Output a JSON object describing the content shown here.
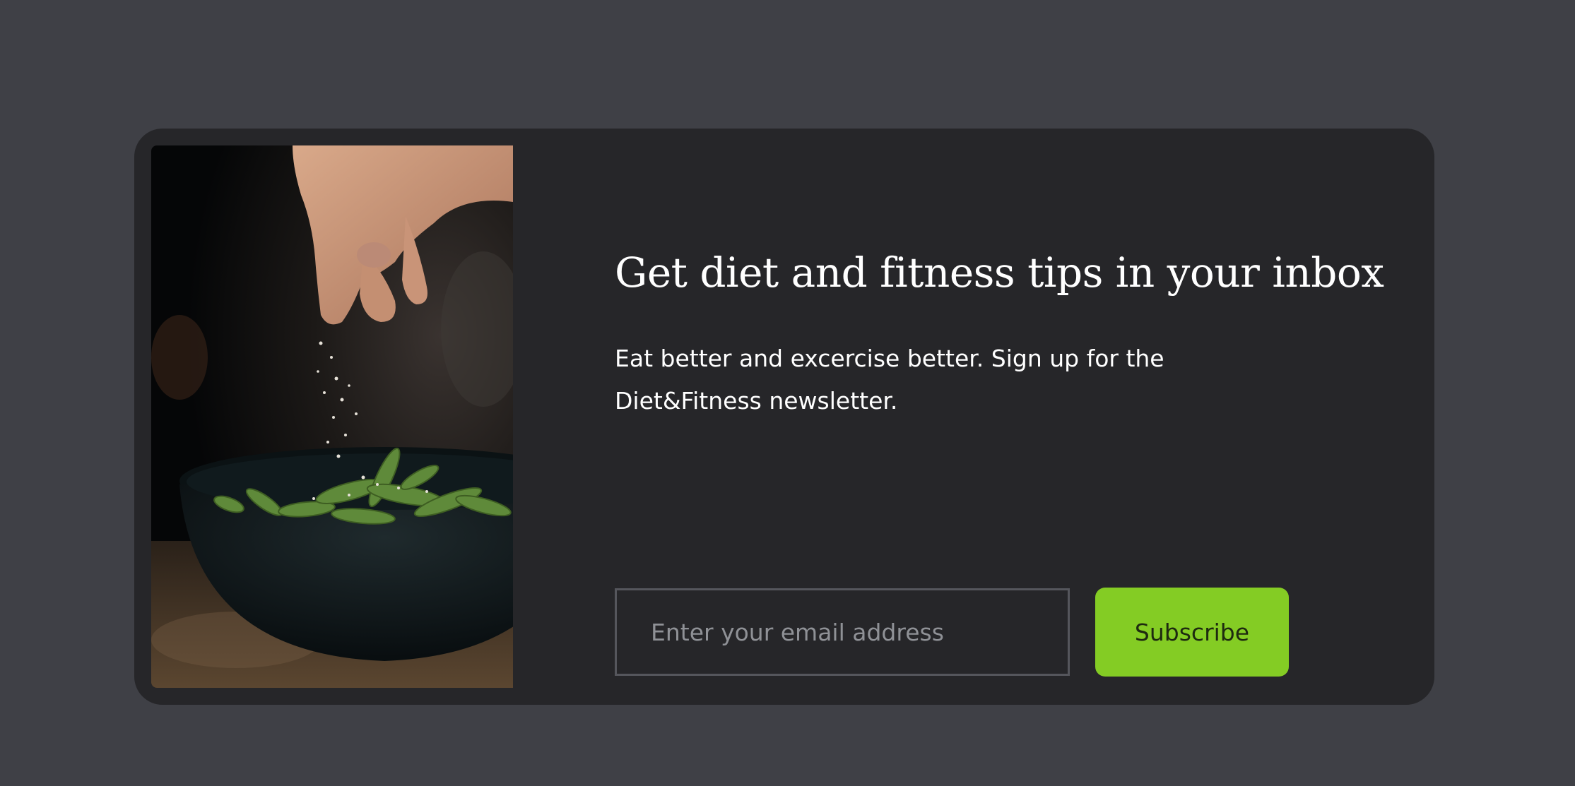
{
  "image": {
    "alt": "Hand sprinkling salt over a bowl of edamame"
  },
  "newsletter": {
    "title": "Get diet and fitness tips in your inbox",
    "description": "Eat better and excercise better. Sign up for the Diet&Fitness newsletter.",
    "email_value": "",
    "email_placeholder": "Enter your email address",
    "subscribe_label": "Subscribe"
  },
  "colors": {
    "page_background": "#3f4046",
    "card_background": "#262629",
    "accent": "#84cc24",
    "input_border": "#55565c",
    "placeholder": "#8f9196"
  }
}
